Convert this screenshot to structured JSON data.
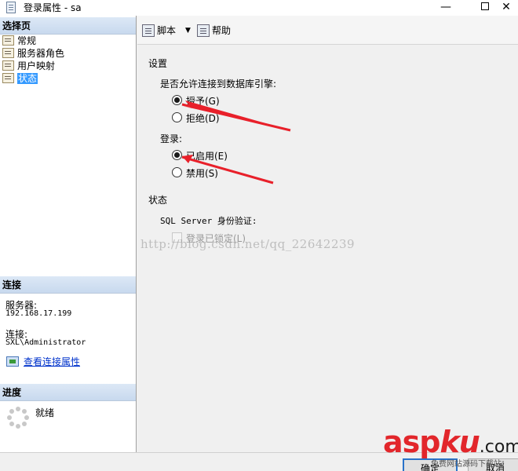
{
  "window": {
    "title": "登录属性 - sa",
    "minimize_glyph": "—",
    "close_glyph": "✕"
  },
  "left_panel": {
    "select_page_header": "选择页",
    "pages": [
      {
        "label": "常规"
      },
      {
        "label": "服务器角色"
      },
      {
        "label": "用户映射"
      },
      {
        "label": "状态",
        "selected": true
      }
    ],
    "connection_header": "连接",
    "server_label": "服务器:",
    "server_value": "192.168.17.199",
    "connection_label": "连接:",
    "connection_value": "SXL\\Administrator",
    "view_connection_link": "查看连接属性",
    "progress_header": "进度",
    "progress_status": "就绪"
  },
  "toolbar": {
    "script_label": "脚本",
    "help_label": "帮助"
  },
  "content": {
    "settings_label": "设置",
    "permission_question": "是否允许连接到数据库引擎:",
    "grant_label": "授予(G)",
    "deny_label": "拒绝(D)",
    "login_label": "登录:",
    "enabled_label": "已启用(E)",
    "disabled_label": "禁用(S)",
    "status_label": "状态",
    "sql_auth_label": "SQL Server 身份验证:",
    "locked_label": "登录已锁定(L)",
    "watermark": "http://blog.csdn.net/qq_22642239"
  },
  "state": {
    "permission": "grant",
    "login": "enabled",
    "locked": false
  },
  "buttons": {
    "ok_label": "确定",
    "cancel_label": "取消"
  },
  "overlay": {
    "logo_part1": "asp",
    "logo_part2": "ku",
    "logo_part3": ".com",
    "logo_subtitle": "免费网站源码下载站!"
  },
  "colors": {
    "arrow": "#e8202a",
    "selection": "#3399ff",
    "link": "#0033cc"
  }
}
